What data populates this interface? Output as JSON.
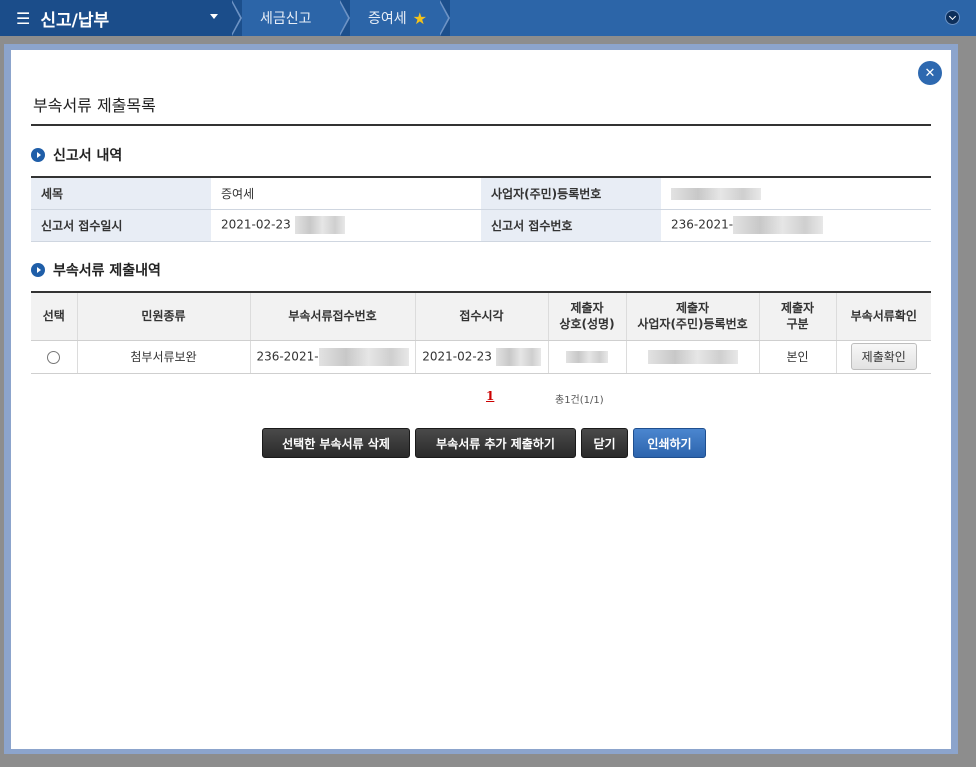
{
  "nav": {
    "menu_title": "신고/납부",
    "breadcrumbs": [
      "세금신고",
      "증여세"
    ]
  },
  "modal": {
    "title": "부속서류 제출목록",
    "close_icon": "close-icon"
  },
  "report_section": {
    "heading": "신고서 내역",
    "rows": [
      {
        "label1": "세목",
        "value1": "증여세",
        "label2": "사업자(주민)등록번호",
        "value2": ""
      },
      {
        "label1": "신고서 접수일시",
        "value1": "2021-02-23",
        "label2": "신고서 접수번호",
        "value2": "236-2021-"
      }
    ]
  },
  "submission_section": {
    "heading": "부속서류 제출내역",
    "columns": [
      "선택",
      "민원종류",
      "부속서류접수번호",
      "접수시각",
      "제출자\n상호(성명)",
      "제출자\n사업자(주민)등록번호",
      "제출자\n구분",
      "부속서류확인"
    ],
    "rows": [
      {
        "type": "첨부서류보완",
        "receipt_no": "236-2021-",
        "time": "2021-02-23",
        "submitter_name": "",
        "submitter_id": "",
        "category": "본인",
        "confirm_label": "제출확인"
      }
    ]
  },
  "pagination": {
    "current_page": "1",
    "summary": "총1건(1/1)"
  },
  "buttons": {
    "delete_selected": "선택한 부속서류 삭제",
    "add_submission": "부속서류 추가 제출하기",
    "close": "닫기",
    "print": "인쇄하기"
  },
  "colors": {
    "nav_blue": "#1c4f8c",
    "accent_blue": "#2e69b0",
    "star": "#f3c21b"
  }
}
